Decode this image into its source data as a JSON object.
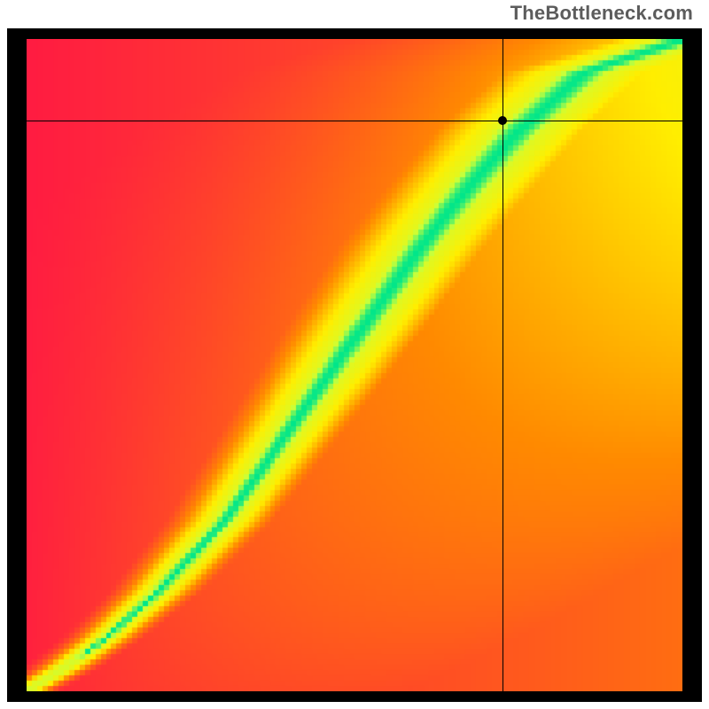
{
  "watermark": "TheBottleneck.com",
  "chart_data": {
    "type": "heatmap",
    "title": "",
    "xlabel": "",
    "ylabel": "",
    "xlim": [
      0,
      1
    ],
    "ylim": [
      0,
      1
    ],
    "grid": false,
    "legend": false,
    "colorscale": [
      {
        "stop": 0.0,
        "color": "#ff1744"
      },
      {
        "stop": 0.35,
        "color": "#ff8a00"
      },
      {
        "stop": 0.55,
        "color": "#ffee00"
      },
      {
        "stop": 0.78,
        "color": "#c8ff3a"
      },
      {
        "stop": 1.0,
        "color": "#00e68a"
      }
    ],
    "ridge_top": [
      {
        "x": 0.0,
        "y": 0.0
      },
      {
        "x": 0.05,
        "y": 0.03
      },
      {
        "x": 0.12,
        "y": 0.08
      },
      {
        "x": 0.2,
        "y": 0.15
      },
      {
        "x": 0.3,
        "y": 0.26
      },
      {
        "x": 0.4,
        "y": 0.4
      },
      {
        "x": 0.5,
        "y": 0.54
      },
      {
        "x": 0.6,
        "y": 0.68
      },
      {
        "x": 0.68,
        "y": 0.78
      },
      {
        "x": 0.75,
        "y": 0.86
      },
      {
        "x": 0.85,
        "y": 0.95
      },
      {
        "x": 1.0,
        "y": 1.0
      }
    ],
    "ridge_width_top": 0.055,
    "ridge_width_bottom": 0.01,
    "crosshair": {
      "x": 0.725,
      "y": 0.875
    },
    "field_corners": {
      "top": 0.58,
      "right": 0.58,
      "bottom": 0.03,
      "left": 0.03
    }
  }
}
